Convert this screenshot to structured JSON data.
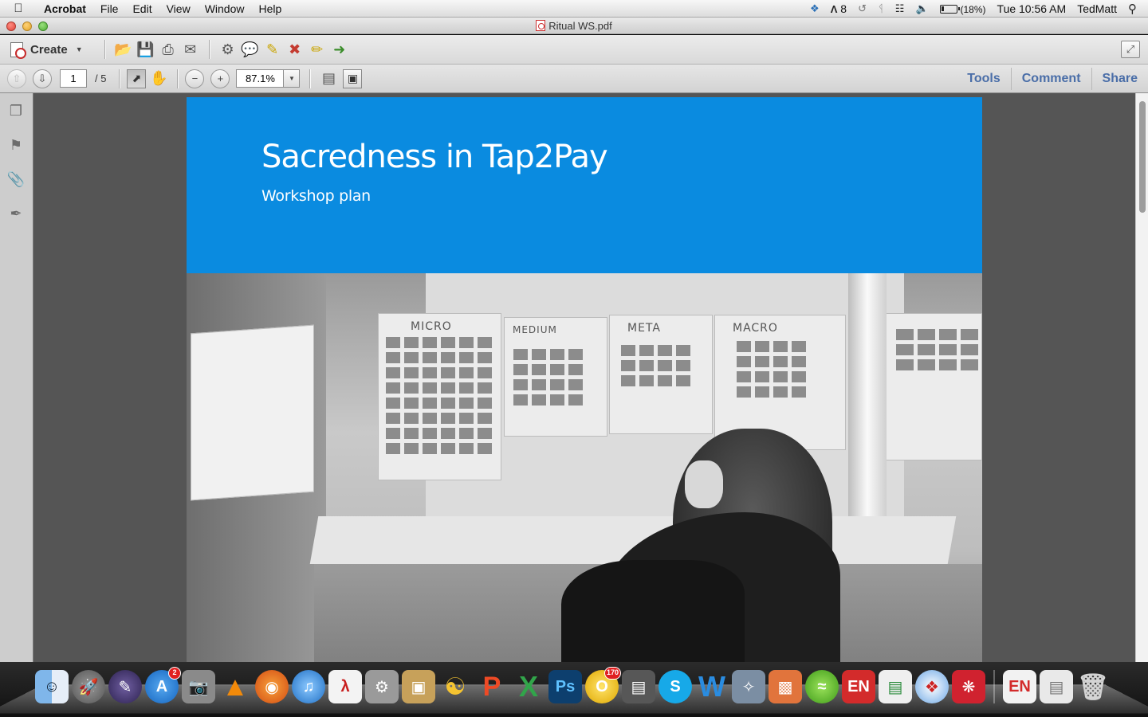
{
  "menubar": {
    "app_name": "Acrobat",
    "menus": [
      "File",
      "Edit",
      "View",
      "Window",
      "Help"
    ],
    "status": {
      "adobe_count": "8",
      "battery": "(18%)",
      "clock": "Tue 10:56 AM",
      "user": "TedMatt"
    }
  },
  "window": {
    "title": "Ritual WS.pdf"
  },
  "toolbar": {
    "create_label": "Create",
    "icons": [
      "open-icon",
      "save-icon",
      "print-icon",
      "email-icon",
      "settings-icon",
      "comment-icon",
      "sticky-note-icon",
      "delete-icon",
      "sign-icon",
      "export-icon"
    ]
  },
  "navigation": {
    "current_page": "1",
    "page_total": "/ 5",
    "zoom": "87.1%"
  },
  "panels": {
    "tools": "Tools",
    "comment": "Comment",
    "share": "Share"
  },
  "document": {
    "title": "Sacredness in Tap2Pay",
    "subtitle": "Workshop plan",
    "banner_color": "#0a8be0",
    "photo_labels": [
      "MICRO",
      "MEDIUM",
      "META",
      "MACRO"
    ]
  },
  "dock": {
    "badges": {
      "app_store": "2",
      "outlook": "170"
    },
    "evernote_label": "EN"
  }
}
